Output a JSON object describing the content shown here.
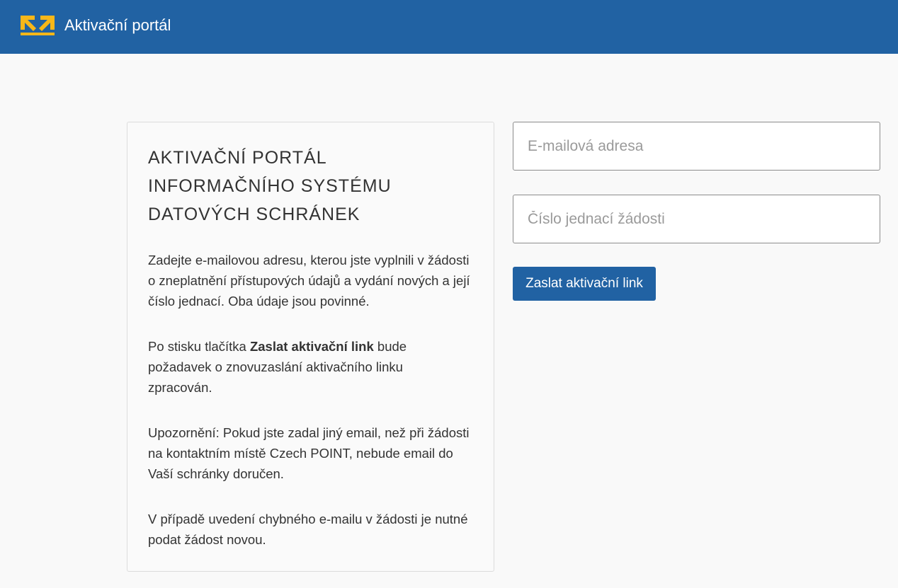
{
  "header": {
    "logo_icon": "arrows-logo-icon",
    "title": "Aktivační portál",
    "background_color": "#2162a3",
    "logo_color": "#f7b719"
  },
  "info_card": {
    "heading": "AKTIVAČNÍ PORTÁL INFORMAČNÍHO SYSTÉMU DATOVÝCH SCHRÁNEK",
    "paragraph_1": "Zadejte e-mailovou adresu, kterou jste vyplnili v žádosti o zneplatnění přístupových údajů a vydání nových a její číslo jednací. Oba údaje jsou povinné.",
    "paragraph_2_prefix": "Po stisku tlačítka ",
    "paragraph_2_bold": "Zaslat aktivační link",
    "paragraph_2_suffix": " bude požadavek o znovuzaslání aktivačního linku zpracován.",
    "paragraph_3": "Upozornění: Pokud jste zadal jiný email, než při žádosti na kontaktním místě Czech POINT, nebude email do Vaší schránky doručen.",
    "paragraph_4": "V případě uvedení chybného e-mailu v žádosti je nutné podat žádost novou."
  },
  "form": {
    "email": {
      "value": "",
      "placeholder": "E-mailová adresa"
    },
    "reference_number": {
      "value": "",
      "placeholder": "Číslo jednací žádosti"
    },
    "submit_label": "Zaslat aktivační link"
  }
}
